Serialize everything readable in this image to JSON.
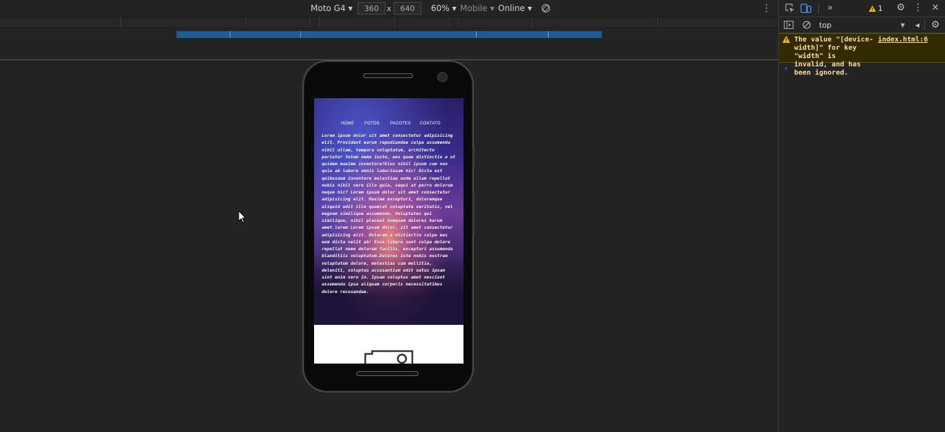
{
  "toolbar": {
    "device": "Moto G4",
    "width": "360",
    "times": "x",
    "height": "640",
    "zoom": "60%",
    "throttle_mode": "Mobile",
    "network": "Online"
  },
  "site": {
    "nav": [
      "HOME",
      "FOTOS",
      "PACOTES",
      "CONTATO"
    ],
    "paragraph": "Lorem ipsum dolor sit amet consectetur adipisicing elit. Provident earum repudiandae culpa assumenda nihil ullam, tempora voluptatum, architecto pariatur totam nemo iusto, eos quae distinctio a ut quidem maxime inventore?Eius nihil ipsum cum non quia ab labore omnis laboriosam hic! Dicta est quibusdam inventore molestiae unde ullam repellat nobis nihil vero illo quia, sequi at porro dolorum neque hic? Lorem ipsum dolor sit amet consectetur adipisicing elit. Maxime excepturi, doloremque aliquid odit illo quaerat voluptate veritatis, vel magnam similique assumenda. Voluptates qui similique, nihil placeat numquam dolores harum amet.lorem Lorem ipsum dolor, sit amet consectetur adipisicing elit. Dolorem a distinctio culpa eos eum dicta velit ab! Esse libero sunt culpa dolore repellat nemo dolorem facilis, excepturi assumenda blanditiis voluptatum.Dolores iste nobis nostrum voluptatum dolore, molestias cum mollitia, deleniti, voluptas accusantium odit natus ipsam sint enim vero in. Ipsam voluptas amet nesciunt assumenda ipsa aliquam corporis necessitatibus dolore recusandae."
  },
  "devtools": {
    "warning_count": "1",
    "context": "top",
    "warning_message": "The value \"[device-\nwidth]\" for key \"width\" is\ninvalid, and has been ignored.",
    "warning_source": "index.html:6",
    "prompt": "›"
  },
  "colors": {
    "accent_blue": "#1e5b94",
    "warning_bg": "#332b00",
    "warning_text": "#ffdd9e",
    "warning_icon": "#f5c400"
  }
}
